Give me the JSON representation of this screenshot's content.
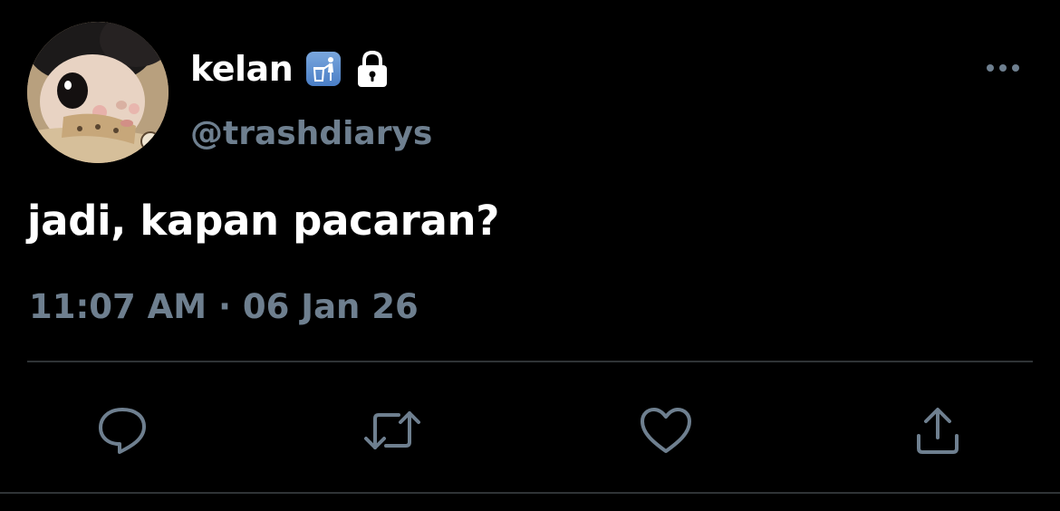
{
  "tweet": {
    "display_name": "kelan",
    "handle": "@trashdiarys",
    "text": "jadi, kapan pacaran?",
    "timestamp": "11:07 AM · 06 Jan 26"
  },
  "icons": {
    "name_badge": "put-litter-in-its-place-icon",
    "protected": "lock-icon",
    "more": "more-options-icon",
    "reply": "reply-icon",
    "retweet": "retweet-icon",
    "like": "like-icon",
    "share": "share-icon"
  },
  "colors": {
    "background": "#000000",
    "primary_text": "#ffffff",
    "secondary_text": "#6e7f8f",
    "divider": "#2f3336",
    "badge_blue": "#5b8fd1"
  }
}
